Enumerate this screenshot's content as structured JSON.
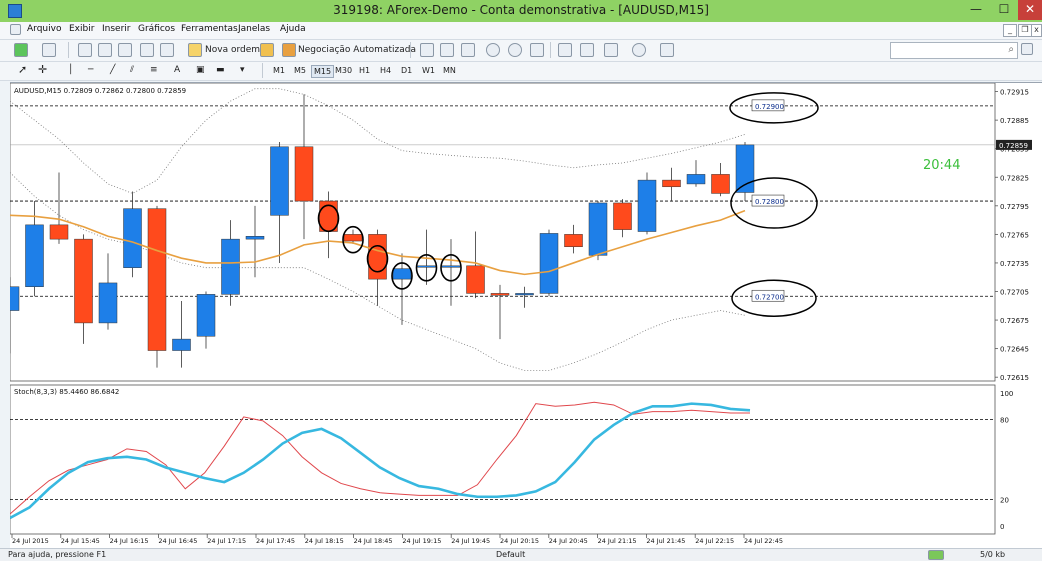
{
  "window": {
    "title": "319198: AForex-Demo - Conta demonstrativa - [AUDUSD,M15]",
    "minimize": "—",
    "maximize": "☐",
    "close": "✕"
  },
  "menu": [
    "Arquivo",
    "Exibir",
    "Inserir",
    "Gráficos",
    "Ferramentas",
    "Janelas",
    "Ajuda"
  ],
  "mdi_controls": [
    "_",
    "❐",
    "x"
  ],
  "toolbar": {
    "new_order": "Nova ordem",
    "auto_trading": "Negociação Automatizada",
    "search_placeholder": ""
  },
  "timeframes": [
    "M1",
    "M5",
    "M15",
    "M30",
    "H1",
    "H4",
    "D1",
    "W1",
    "MN"
  ],
  "active_timeframe": "M15",
  "status": {
    "help": "Para ajuda, pressione F1",
    "profile": "Default",
    "traffic": "5/0 kb"
  },
  "colors": {
    "bull": "#1e7fe8",
    "bear": "#ff4a1c",
    "ma": "#e8a040",
    "stoch_main": "#37b8e0",
    "stoch_signal": "#e0474c",
    "time": "#3cbf3c",
    "titlebar": "#8fd264"
  },
  "chart_data": {
    "type": "candlestick",
    "symbol_header": "AUDUSD,M15  0.72809 0.72862 0.72800 0.72859",
    "price_labels": [
      "0.72915",
      "0.72885",
      "0.72855",
      "0.72825",
      "0.72795",
      "0.72765",
      "0.72735",
      "0.72705",
      "0.72675",
      "0.72645",
      "0.72615"
    ],
    "ylim": [
      0.72611,
      0.72924
    ],
    "current_price": "0.72859",
    "countdown": "20:44",
    "level_lines": [
      0.729,
      0.728,
      0.727
    ],
    "annotations": [
      "0.72900",
      "0.72800",
      "0.72700"
    ],
    "candles": [
      {
        "o": 0.72685,
        "h": 0.7272,
        "l": 0.7264,
        "c": 0.7271
      },
      {
        "o": 0.7271,
        "h": 0.728,
        "l": 0.727,
        "c": 0.72775
      },
      {
        "o": 0.72775,
        "h": 0.7283,
        "l": 0.72755,
        "c": 0.7276
      },
      {
        "o": 0.7276,
        "h": 0.72765,
        "l": 0.7265,
        "c": 0.72672
      },
      {
        "o": 0.72672,
        "h": 0.72745,
        "l": 0.72665,
        "c": 0.72714
      },
      {
        "o": 0.7273,
        "h": 0.7281,
        "l": 0.7272,
        "c": 0.72792
      },
      {
        "o": 0.72792,
        "h": 0.72795,
        "l": 0.72625,
        "c": 0.72643
      },
      {
        "o": 0.72643,
        "h": 0.72695,
        "l": 0.72625,
        "c": 0.72655
      },
      {
        "o": 0.72658,
        "h": 0.72705,
        "l": 0.72645,
        "c": 0.72702
      },
      {
        "o": 0.72702,
        "h": 0.7278,
        "l": 0.7269,
        "c": 0.7276
      },
      {
        "o": 0.7276,
        "h": 0.72795,
        "l": 0.7272,
        "c": 0.72763
      },
      {
        "o": 0.72785,
        "h": 0.72862,
        "l": 0.72735,
        "c": 0.72857
      },
      {
        "o": 0.72857,
        "h": 0.72912,
        "l": 0.7276,
        "c": 0.728
      },
      {
        "o": 0.728,
        "h": 0.7281,
        "l": 0.7274,
        "c": 0.72768
      },
      {
        "o": 0.72765,
        "h": 0.7277,
        "l": 0.72755,
        "c": 0.72758
      },
      {
        "o": 0.72765,
        "h": 0.7277,
        "l": 0.7269,
        "c": 0.72718
      },
      {
        "o": 0.72718,
        "h": 0.72745,
        "l": 0.7267,
        "c": 0.72729
      },
      {
        "o": 0.72732,
        "h": 0.7277,
        "l": 0.72712,
        "c": 0.72732
      },
      {
        "o": 0.72732,
        "h": 0.7276,
        "l": 0.7269,
        "c": 0.72732
      },
      {
        "o": 0.72732,
        "h": 0.72768,
        "l": 0.72698,
        "c": 0.72703
      },
      {
        "o": 0.72703,
        "h": 0.72712,
        "l": 0.72655,
        "c": 0.72701
      },
      {
        "o": 0.72702,
        "h": 0.7271,
        "l": 0.72688,
        "c": 0.72703
      },
      {
        "o": 0.72703,
        "h": 0.7277,
        "l": 0.727,
        "c": 0.72766
      },
      {
        "o": 0.72765,
        "h": 0.72775,
        "l": 0.72745,
        "c": 0.72752
      },
      {
        "o": 0.72743,
        "h": 0.728,
        "l": 0.72738,
        "c": 0.72798
      },
      {
        "o": 0.72798,
        "h": 0.72802,
        "l": 0.72762,
        "c": 0.7277
      },
      {
        "o": 0.72768,
        "h": 0.7283,
        "l": 0.72765,
        "c": 0.72822
      },
      {
        "o": 0.72822,
        "h": 0.72835,
        "l": 0.728,
        "c": 0.72815
      },
      {
        "o": 0.72818,
        "h": 0.72843,
        "l": 0.72815,
        "c": 0.72828
      },
      {
        "o": 0.72828,
        "h": 0.7284,
        "l": 0.72805,
        "c": 0.72808
      },
      {
        "o": 0.72809,
        "h": 0.72862,
        "l": 0.728,
        "c": 0.72859
      }
    ],
    "ma": [
      0.72785,
      0.72784,
      0.72781,
      0.72773,
      0.72763,
      0.72757,
      0.72748,
      0.7274,
      0.72735,
      0.72735,
      0.72736,
      0.72743,
      0.72754,
      0.72758,
      0.72756,
      0.72748,
      0.72742,
      0.7274,
      0.72738,
      0.72735,
      0.72727,
      0.72723,
      0.72726,
      0.72735,
      0.72744,
      0.72752,
      0.7276,
      0.72767,
      0.72774,
      0.7278,
      0.7279
    ],
    "bands_upper": [
      0.72905,
      0.72885,
      0.72865,
      0.7284,
      0.72818,
      0.72808,
      0.72822,
      0.72857,
      0.72885,
      0.72905,
      0.72918,
      0.72918,
      0.72912,
      0.729,
      0.72885,
      0.72865,
      0.72853,
      0.7285,
      0.72848,
      0.72846,
      0.72845,
      0.72842,
      0.72838,
      0.72835,
      0.72838,
      0.7284,
      0.72845,
      0.7285,
      0.72856,
      0.72862,
      0.7287
    ],
    "bands_lower": [
      0.7283,
      0.72805,
      0.72785,
      0.7277,
      0.7276,
      0.72754,
      0.72745,
      0.72735,
      0.7273,
      0.7273,
      0.7273,
      0.7273,
      0.7273,
      0.72718,
      0.72705,
      0.7269,
      0.72675,
      0.72665,
      0.72655,
      0.72645,
      0.7263,
      0.72622,
      0.72622,
      0.7263,
      0.7264,
      0.72652,
      0.72665,
      0.72675,
      0.7268,
      0.72685,
      0.7268
    ],
    "stoch": {
      "header": "Stoch(8,3,3) 85.4460 86.6842",
      "levels": [
        80,
        20
      ],
      "axis_labels": [
        "100",
        "80",
        "20",
        "0"
      ],
      "main": [
        6,
        14,
        28,
        40,
        48,
        51,
        52,
        50,
        44,
        40,
        36,
        33,
        40,
        50,
        62,
        70,
        73,
        66,
        55,
        44,
        36,
        30,
        28,
        24,
        22,
        22,
        23,
        26,
        33,
        48,
        65,
        76,
        85,
        90,
        90,
        92,
        91,
        88,
        87
      ],
      "signal": [
        9,
        22,
        34,
        42,
        46,
        50,
        58,
        56,
        46,
        28,
        40,
        60,
        82,
        79,
        68,
        52,
        40,
        32,
        28,
        25,
        24,
        23,
        23,
        23,
        31,
        50,
        68,
        92,
        90,
        91,
        93,
        91,
        84,
        86,
        86,
        87,
        86,
        85,
        85
      ]
    },
    "x_labels": [
      "24 Jul 2015",
      "24 Jul 15:45",
      "24 Jul 16:15",
      "24 Jul 16:45",
      "24 Jul 17:15",
      "24 Jul 17:45",
      "24 Jul 18:15",
      "24 Jul 18:45",
      "24 Jul 19:15",
      "24 Jul 19:45",
      "24 Jul 20:15",
      "24 Jul 20:45",
      "24 Jul 21:15",
      "24 Jul 21:45",
      "24 Jul 22:15",
      "24 Jul 22:45"
    ]
  }
}
